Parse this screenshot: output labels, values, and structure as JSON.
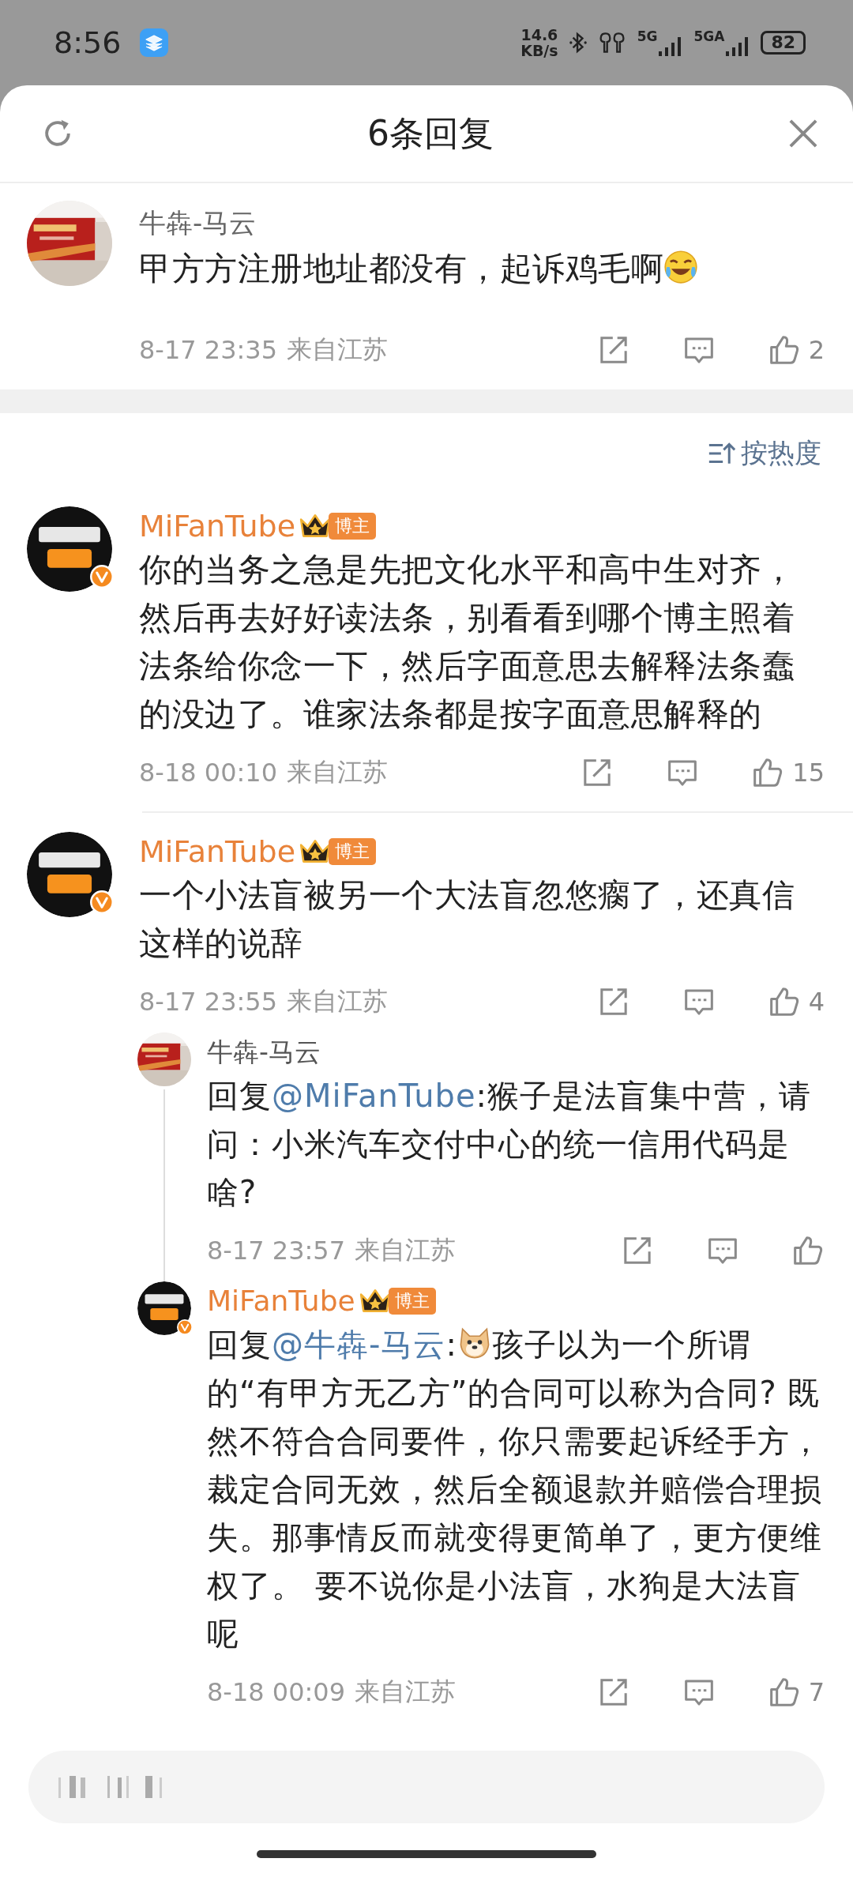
{
  "status_bar": {
    "time": "8:56",
    "net_speed": "14.6",
    "net_unit": "KB/s",
    "signal_1": "5G",
    "signal_2": "5GA",
    "battery": "82"
  },
  "sheet": {
    "title": "6条回复"
  },
  "root_comment": {
    "author": "牛犇-马云",
    "body": [
      {
        "kind": "text",
        "text": "甲方方注册地址都没有，起诉鸡毛啊"
      },
      {
        "kind": "laughing-emoji"
      }
    ],
    "time": "8-17 23:35",
    "location": "来自江苏",
    "likes": "2"
  },
  "sort": {
    "label": "按热度"
  },
  "replies": [
    {
      "author": "MiFanTube",
      "verified": true,
      "vip": true,
      "badge": "博主",
      "body": [
        {
          "kind": "text",
          "text": "你的当务之急是先把文化水平和高中生对齐，然后再去好好读法条，别看看到哪个博主照着法条给你念一下，然后字面意思去解释法条蠢的没边了。谁家法条都是按字面意思解释的"
        }
      ],
      "time": "8-18 00:10",
      "location": "来自江苏",
      "likes": "15"
    },
    {
      "author": "MiFanTube",
      "verified": true,
      "vip": true,
      "badge": "博主",
      "body": [
        {
          "kind": "text",
          "text": "一个小法盲被另一个大法盲忽悠瘸了，还真信这样的说辞"
        }
      ],
      "time": "8-17 23:55",
      "location": "来自江苏",
      "likes": "4",
      "children": [
        {
          "author": "牛犇-马云",
          "verified": false,
          "vip": false,
          "body": [
            {
              "kind": "text",
              "text": "回复"
            },
            {
              "kind": "mention",
              "text": "@MiFanTube"
            },
            {
              "kind": "text",
              "text": ":猴子是法盲集中营，请问：小米汽车交付中心的统一信用代码是啥?"
            }
          ],
          "time": "8-17 23:57",
          "location": "来自江苏"
        },
        {
          "author": "MiFanTube",
          "verified": true,
          "vip": true,
          "badge": "博主",
          "body": [
            {
              "kind": "text",
              "text": "回复"
            },
            {
              "kind": "mention",
              "text": "@牛犇-马云"
            },
            {
              "kind": "text",
              "text": ":"
            },
            {
              "kind": "dog-emoji"
            },
            {
              "kind": "text",
              "text": "孩子以为一个所谓的“有甲方无乙方”的合同可以称为合同? 既然不符合合同要件，你只需要起诉经手方，裁定合同无效，然后全额退款并赔偿合理损失。那事情反而就变得更简单了，更方便维权了。 要不说你是小法盲，水狗是大法盲呢"
            }
          ],
          "time": "8-18 00:09",
          "location": "来自江苏",
          "likes": "7"
        }
      ]
    }
  ]
}
